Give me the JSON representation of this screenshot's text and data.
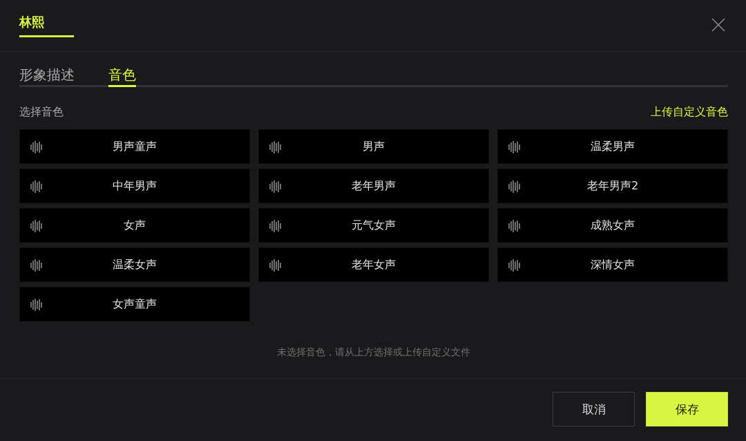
{
  "dialog": {
    "title": "林熙"
  },
  "tabs": [
    {
      "label": "形象描述",
      "selected": false
    },
    {
      "label": "音色",
      "selected": true
    }
  ],
  "voice_section": {
    "label": "选择音色",
    "upload_link": "上传自定义音色"
  },
  "voices": [
    {
      "name": "男声童声",
      "selected": false
    },
    {
      "name": "男声",
      "selected": false
    },
    {
      "name": "温柔男声",
      "selected": false
    },
    {
      "name": "中年男声",
      "selected": false
    },
    {
      "name": "老年男声",
      "selected": false
    },
    {
      "name": "老年男声2",
      "selected": false
    },
    {
      "name": "女声",
      "selected": false
    },
    {
      "name": "元气女声",
      "selected": false
    },
    {
      "name": "成熟女声",
      "selected": false
    },
    {
      "name": "温柔女声",
      "selected": false
    },
    {
      "name": "老年女声",
      "selected": false
    },
    {
      "name": "深情女声",
      "selected": false
    },
    {
      "name": "女声童声",
      "selected": false
    }
  ],
  "empty_hint": "未选择音色，请从上方选择或上传自定义文件",
  "buttons": [
    {
      "label": "取消",
      "kind": "secondary"
    },
    {
      "label": "保存",
      "kind": "primary"
    }
  ]
}
